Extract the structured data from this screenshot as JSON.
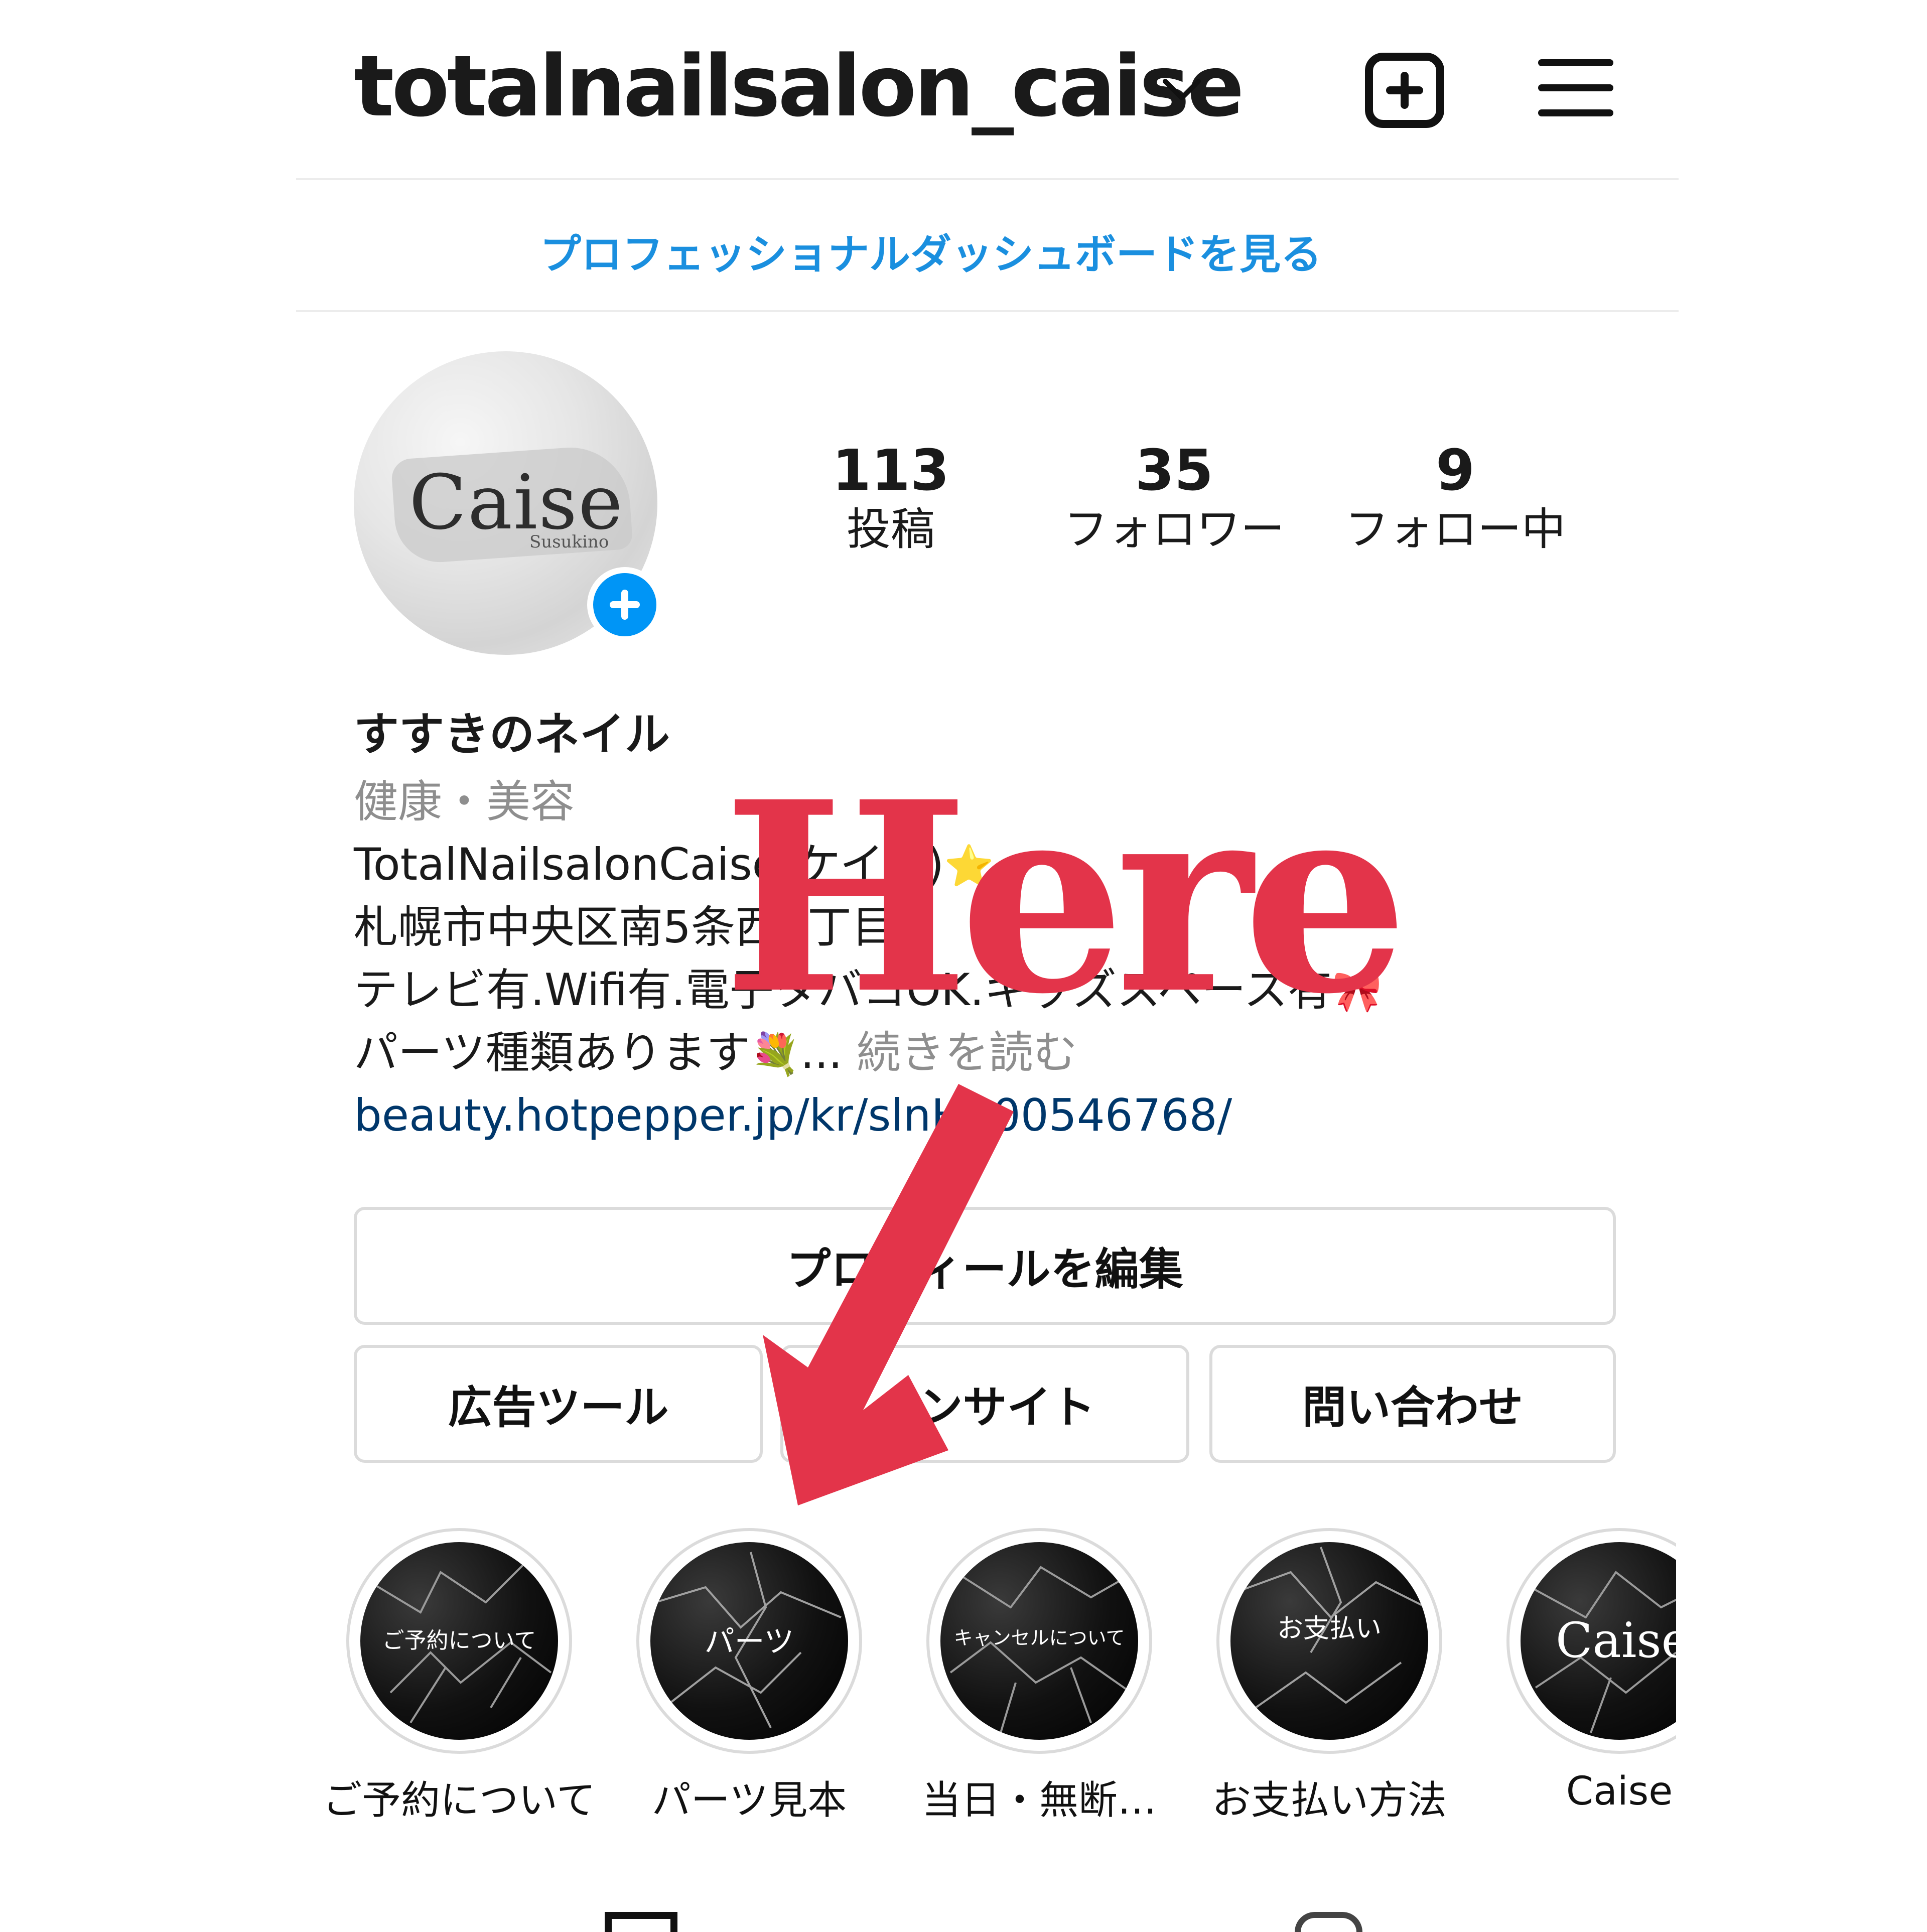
{
  "header": {
    "username": "totalnailsalon_caise"
  },
  "dashboard_link": "プロフェッショナルダッシュボードを見る",
  "avatar": {
    "brand": "Caise",
    "sub": "Susukino"
  },
  "stats": [
    {
      "value": "113",
      "label": "投稿"
    },
    {
      "value": "35",
      "label": "フォロワー"
    },
    {
      "value": "9",
      "label": "フォロー中"
    }
  ],
  "bio": {
    "display_name": "すすきのネイル",
    "category": "健康・美容",
    "line1": "TotalNailsalonCaise(ケイス)",
    "line1_emoji": "⭐",
    "line2": "札幌市中央区南5条西1丁目",
    "line3": "テレビ有.Wifi有.電子タバコOK.キッズスペース有",
    "line3_emoji": "🎀",
    "line4": "パーツ種類あります",
    "line4_emoji": "💐",
    "ellipsis": "...",
    "read_more": "続きを読む",
    "link": "beauty.hotpepper.jp/kr/slnH000546768/"
  },
  "buttons": {
    "edit_profile": "プロフィールを編集",
    "ads_tools": "広告ツール",
    "insights": "インサイト",
    "contact": "問い合わせ"
  },
  "highlights": [
    {
      "label": "ご予約について",
      "cover_text": "ご予約について"
    },
    {
      "label": "パーツ見本",
      "cover_text": "パーツ"
    },
    {
      "label": "当日・無断…",
      "cover_text": "キャンセルについて"
    },
    {
      "label": "お支払い方法",
      "cover_text": "お支払い"
    },
    {
      "label": "Caise",
      "cover_text": "Caise"
    }
  ],
  "annotation": {
    "text": "Here",
    "color": "#e3344a"
  },
  "colors": {
    "link_blue": "#1a8fdf",
    "add_blue": "#0095f6",
    "url_navy": "#00376b",
    "muted_gray": "#8e8e8e"
  },
  "icons": [
    "chevron-down-icon",
    "new-post-icon",
    "menu-icon",
    "add-story-icon",
    "grid-icon",
    "tagged-icon",
    "down-arrow-annotation"
  ]
}
